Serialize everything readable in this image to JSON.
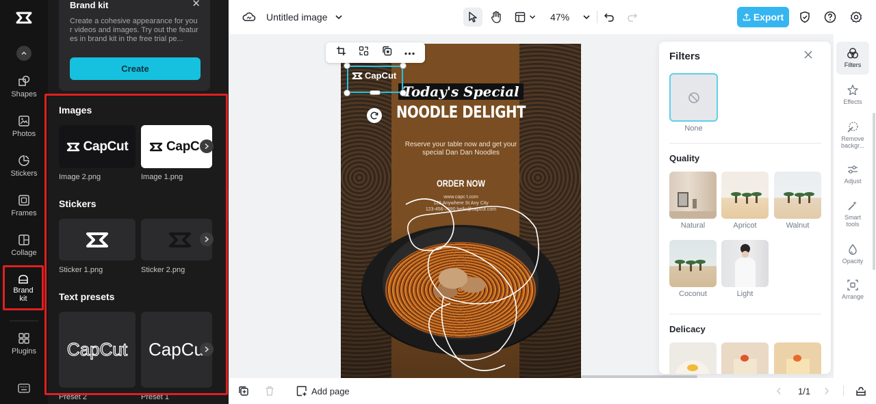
{
  "left_rail": {
    "items": [
      {
        "label": "Shapes",
        "icon": "shapes-icon"
      },
      {
        "label": "Photos",
        "icon": "photos-icon"
      },
      {
        "label": "Stickers",
        "icon": "stickers-icon"
      },
      {
        "label": "Frames",
        "icon": "frames-icon"
      },
      {
        "label": "Collage",
        "icon": "collage-icon"
      },
      {
        "label": "Brand kit",
        "icon": "brand-kit-icon",
        "active": true
      },
      {
        "label": "Plugins",
        "icon": "plugins-icon"
      }
    ],
    "keyboard_icon": "keyboard-icon"
  },
  "brand_panel": {
    "promo": {
      "title": "Brand kit",
      "text": "Create a cohesive appearance for your videos and images. Try out the features in brand kit in the free trial pe...",
      "button": "Create"
    },
    "images": {
      "title": "Images",
      "items": [
        {
          "label": "Image 2.png",
          "thumb_text": "CapCut",
          "theme": "dark"
        },
        {
          "label": "Image 1.png",
          "thumb_text": "CapCut",
          "theme": "light"
        }
      ]
    },
    "stickers": {
      "title": "Stickers",
      "items": [
        {
          "label": "Sticker 1.png"
        },
        {
          "label": "Sticker 2.png"
        }
      ]
    },
    "text_presets": {
      "title": "Text presets",
      "items": [
        {
          "label": "Preset 2",
          "sample": "CapCut"
        },
        {
          "label": "Preset 1",
          "sample": "CapCut"
        }
      ]
    }
  },
  "topbar": {
    "title": "Untitled image",
    "zoom": "47%",
    "export_label": "Export"
  },
  "poster": {
    "logo_text": "CapCut",
    "headline_1": "Today's Special",
    "headline_2": "NOODLE DELIGHT",
    "reserve_text": "Reserve your table now and get your special Dan Dan Noodles",
    "order": "ORDER NOW",
    "contact_1": "www.capc t.com",
    "contact_2": "123 Anywhere St  Any City",
    "contact_3": "123-456-7890  hello@capcut.com"
  },
  "filters": {
    "title": "Filters",
    "none_label": "None",
    "quality_title": "Quality",
    "quality_items": [
      "Natural",
      "Apricot",
      "Walnut",
      "Coconut",
      "Light"
    ],
    "delicacy_title": "Delicacy"
  },
  "tools": [
    {
      "label": "Filters",
      "active": true
    },
    {
      "label": "Effects"
    },
    {
      "label": "Remove backgr..."
    },
    {
      "label": "Adjust"
    },
    {
      "label": "Smart tools"
    },
    {
      "label": "Opacity"
    },
    {
      "label": "Arrange"
    }
  ],
  "bottombar": {
    "add_page": "Add page",
    "page_indicator": "1/1"
  },
  "colors": {
    "accent": "#15c1de",
    "export": "#35b6f0",
    "highlight_box": "#e01f1f",
    "rail_bg": "#141414",
    "panel_bg": "#1b1b1c"
  }
}
